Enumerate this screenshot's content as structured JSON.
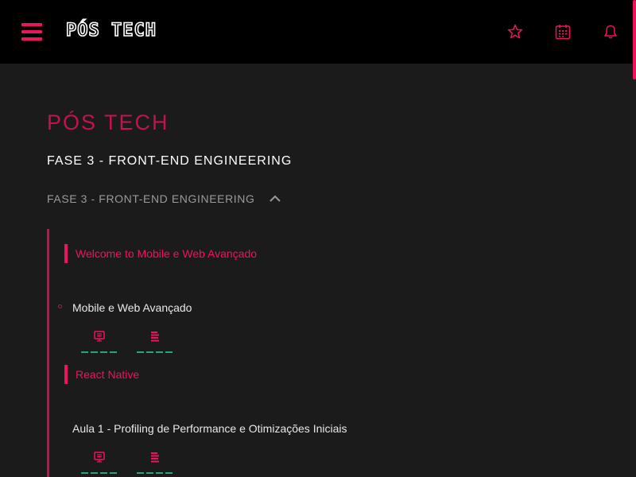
{
  "header": {
    "logo": "PÓS TECH",
    "icons": [
      "menu-icon",
      "star-icon",
      "calendar-icon",
      "bell-icon"
    ]
  },
  "colors": {
    "accent": "#ed145b",
    "accent_dark": "#c2134f",
    "background": "#1c1b1c",
    "header": "#000000",
    "progress": "#2ea37b"
  },
  "main": {
    "title": "PÓS TECH",
    "phase_title": "FASE 3 - FRONT-END ENGINEERING",
    "accordion_label": "FASE 3 - FRONT-END ENGINEERING",
    "modules": [
      {
        "label": "Welcome to Mobile e Web Avançado",
        "lessons": [
          {
            "label": "Mobile e Web Avançado",
            "icons": [
              "video-lesson-icon",
              "reading-icon"
            ]
          }
        ]
      },
      {
        "label": "React Native",
        "lessons": [
          {
            "label": "Aula 1 - Profiling de Performance e Otimizações Iniciais",
            "icons": [
              "video-lesson-icon",
              "reading-icon"
            ]
          }
        ]
      }
    ]
  }
}
